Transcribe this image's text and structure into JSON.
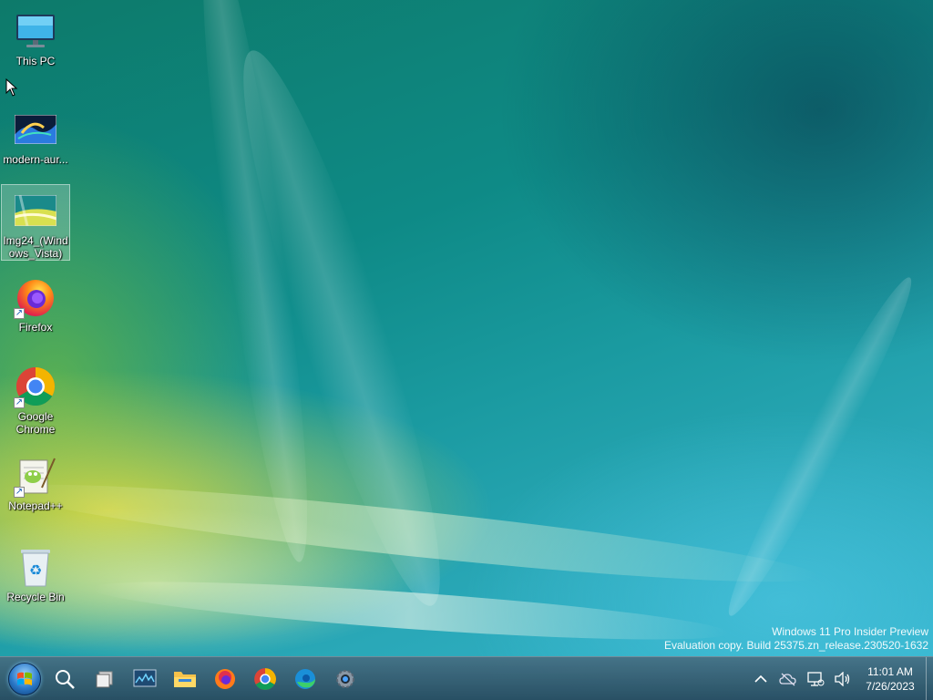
{
  "desktop": {
    "icons": [
      {
        "label": "This PC",
        "icon": "monitor-icon"
      },
      {
        "label": "modern-aur...",
        "icon": "image-file-icon"
      },
      {
        "label": "Img24_(Windows_Vista)",
        "icon": "image-file-icon",
        "selected": true
      },
      {
        "label": "Firefox",
        "icon": "firefox-icon",
        "shortcut": true
      },
      {
        "label": "Google Chrome",
        "icon": "chrome-icon",
        "shortcut": true
      },
      {
        "label": "Notepad++",
        "icon": "notepadpp-icon",
        "shortcut": true
      },
      {
        "label": "Recycle Bin",
        "icon": "recycle-bin-icon"
      }
    ]
  },
  "watermark": {
    "line1": "Windows 11 Pro Insider Preview",
    "line2": "Evaluation copy. Build 25375.zn_release.230520-1632"
  },
  "taskbar": {
    "pinned": [
      "start-orb-icon",
      "search-icon",
      "task-view-icon",
      "task-manager-icon",
      "file-explorer-icon",
      "firefox-icon",
      "chrome-icon",
      "edge-icon",
      "settings-icon"
    ],
    "tray": [
      "chevron-up-icon",
      "onedrive-offline-icon",
      "network-icon",
      "volume-icon"
    ],
    "clock": {
      "time": "11:01 AM",
      "date": "7/26/2023"
    }
  },
  "colors": {
    "taskbar": "#3f6a80",
    "accent": "#2a78c8"
  }
}
